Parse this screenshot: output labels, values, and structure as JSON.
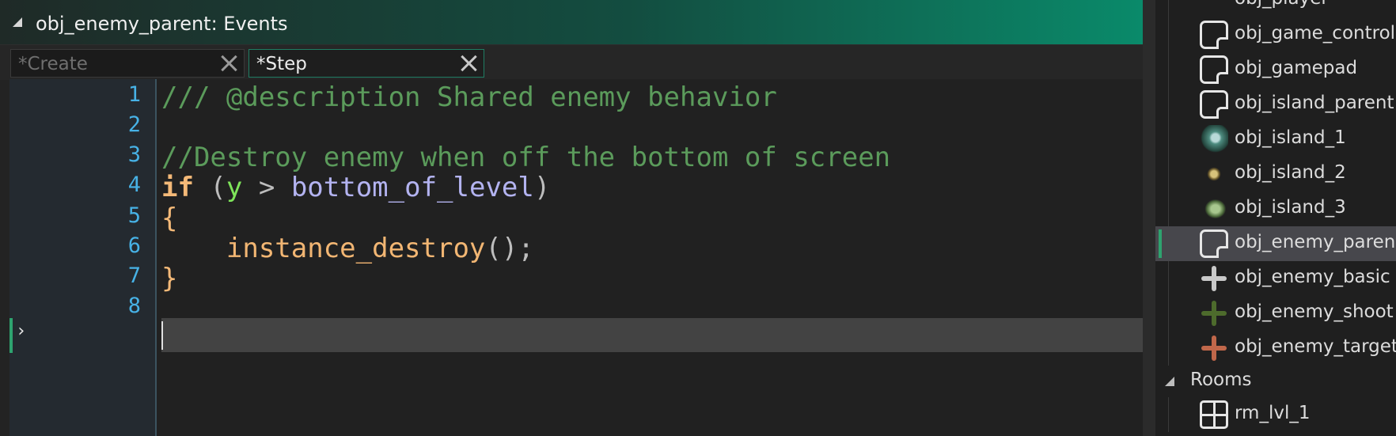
{
  "window": {
    "title": "obj_enemy_parent: Events"
  },
  "tabs": [
    {
      "label": "*Create",
      "active": false
    },
    {
      "label": "*Step",
      "active": true
    }
  ],
  "code": {
    "line_numbers": [
      "1",
      "2",
      "3",
      "4",
      "5",
      "6",
      "7",
      "8"
    ],
    "current_line": 8,
    "lines": {
      "l1_comment": "/// @description Shared enemy behavior",
      "l3_comment": "//Destroy enemy when off the bottom of screen",
      "l4_if": "if",
      "l4_open": " (",
      "l4_var": "y",
      "l4_op": " > ",
      "l4_field": "bottom_of_level",
      "l4_close": ")",
      "l5_brace": "{",
      "l6_indent": "    ",
      "l6_fn": "instance_destroy",
      "l6_rest": "();",
      "l7_brace": "}"
    }
  },
  "resource_tree": {
    "partial_top_item": "obj_player",
    "objects": [
      {
        "label": "obj_game_controller",
        "icon": "object-icon"
      },
      {
        "label": "obj_gamepad",
        "icon": "object-icon"
      },
      {
        "label": "obj_island_parent",
        "icon": "object-icon"
      },
      {
        "label": "obj_island_1",
        "icon": "island-sprite-icon"
      },
      {
        "label": "obj_island_2",
        "icon": "island-sprite-icon"
      },
      {
        "label": "obj_island_3",
        "icon": "island-sprite-icon"
      },
      {
        "label": "obj_enemy_parent",
        "icon": "object-icon",
        "selected": true
      },
      {
        "label": "obj_enemy_basic",
        "icon": "plane-sprite-icon"
      },
      {
        "label": "obj_enemy_shoot",
        "icon": "plane-sprite-icon"
      },
      {
        "label": "obj_enemy_target",
        "icon": "plane-sprite-icon"
      }
    ],
    "group": {
      "label": "Rooms"
    },
    "rooms": [
      {
        "label": "rm_lvl_1",
        "icon": "room-icon"
      }
    ]
  },
  "colors": {
    "accent_green": "#2ea36f",
    "line_number_blue": "#47b2e6",
    "comment_green": "#5b9b5b",
    "keyword_orange": "#f4b978"
  }
}
